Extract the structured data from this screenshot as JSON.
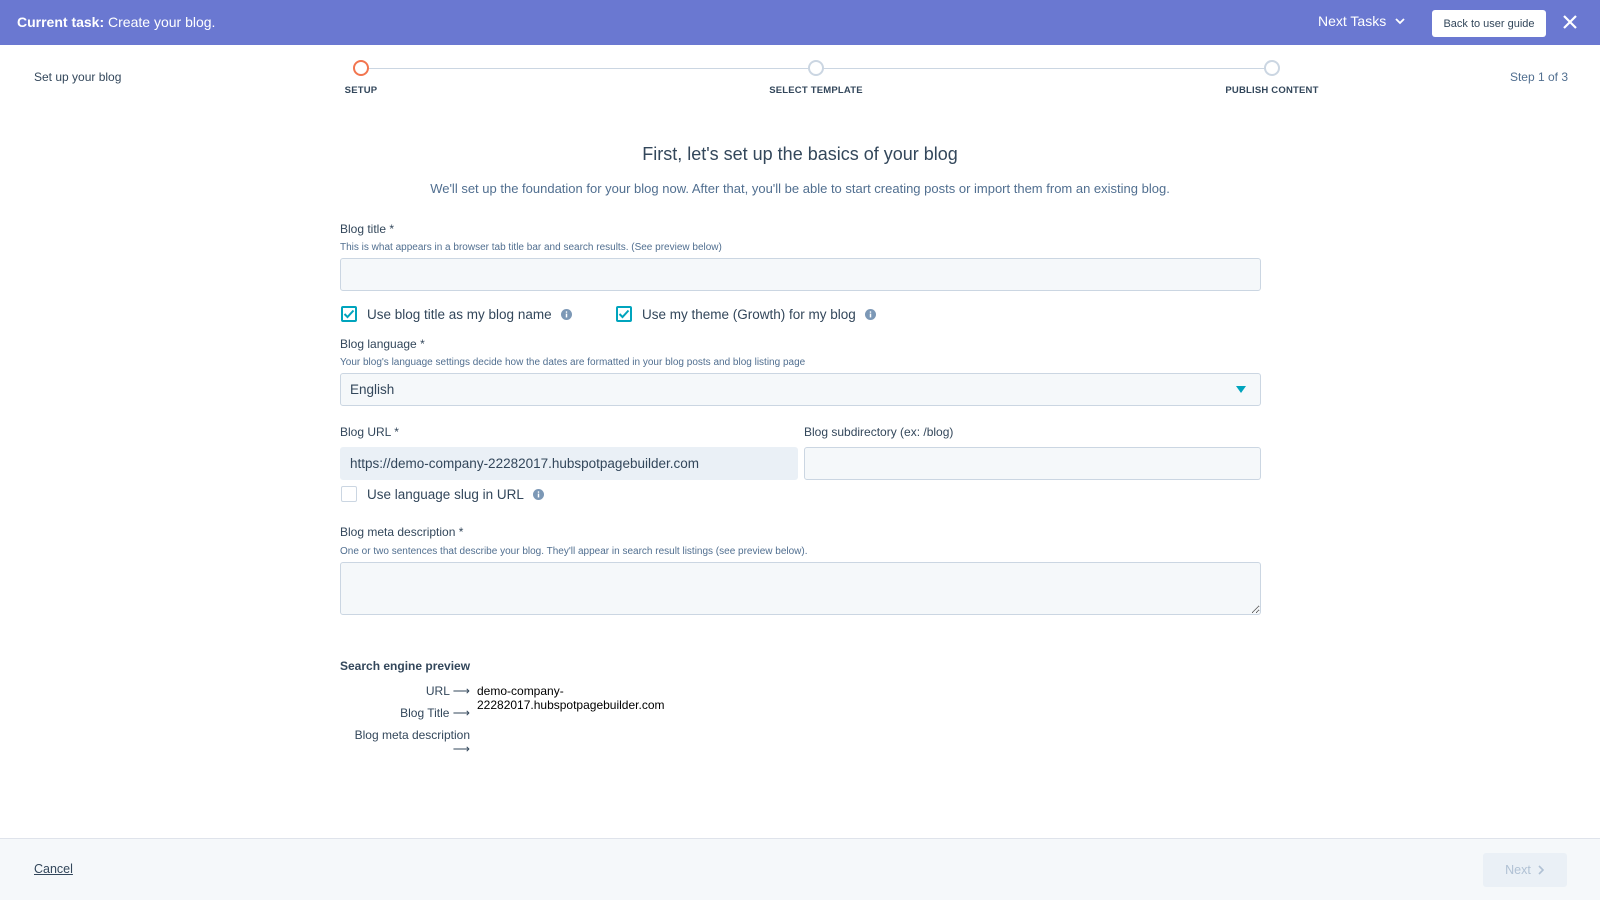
{
  "banner": {
    "task_prefix": "Current task:",
    "task_text": " Create your blog.",
    "next_tasks_label": "Next Tasks",
    "guide_button": "Back to user guide"
  },
  "stepper": {
    "page_label": "Set up your blog",
    "step_count": "Step 1 of 3",
    "steps": [
      {
        "label": "SETUP",
        "active": true
      },
      {
        "label": "SELECT TEMPLATE",
        "active": false
      },
      {
        "label": "PUBLISH CONTENT",
        "active": false
      }
    ]
  },
  "form": {
    "heading": "First, let's set up the basics of your blog",
    "subheading": "We'll set up the foundation for your blog now. After that, you'll be able to start creating posts or import them from an existing blog.",
    "blog_title": {
      "label": "Blog title *",
      "help": "This is what appears in a browser tab title bar and search results. (See preview below)",
      "value": ""
    },
    "checkboxes": {
      "use_title_as_name": {
        "label": "Use blog title as my blog name",
        "checked": true
      },
      "use_theme": {
        "label": "Use my theme (Growth) for my blog",
        "checked": true
      },
      "language_slug": {
        "label": "Use language slug in URL",
        "checked": false
      }
    },
    "blog_language": {
      "label": "Blog language *",
      "help": "Your blog's language settings decide how the dates are formatted in your blog posts and blog listing page",
      "selected": "English"
    },
    "blog_url": {
      "label": "Blog URL *",
      "value": "https://demo-company-22282017.hubspotpagebuilder.com"
    },
    "blog_subdirectory": {
      "label": "Blog subdirectory (ex: /blog)",
      "value": ""
    },
    "meta_description": {
      "label": "Blog meta description *",
      "help": "One or two sentences that describe your blog. They'll appear in search result listings (see preview below).",
      "value": ""
    }
  },
  "preview": {
    "title": "Search engine preview",
    "rows": [
      {
        "key": "URL",
        "arrow": "⟶",
        "value": "demo-company-22282017.hubspotpagebuilder.com"
      },
      {
        "key": "Blog Title",
        "arrow": "⟶",
        "value": ""
      },
      {
        "key": "Blog meta description",
        "arrow": "⟶",
        "value": ""
      }
    ]
  },
  "footer": {
    "cancel_label": "Cancel",
    "next_label": "Next"
  },
  "colors": {
    "banner": "#6a78d1",
    "accent_teal": "#00a4bd",
    "active_step": "#f2754f",
    "text": "#33475b"
  }
}
